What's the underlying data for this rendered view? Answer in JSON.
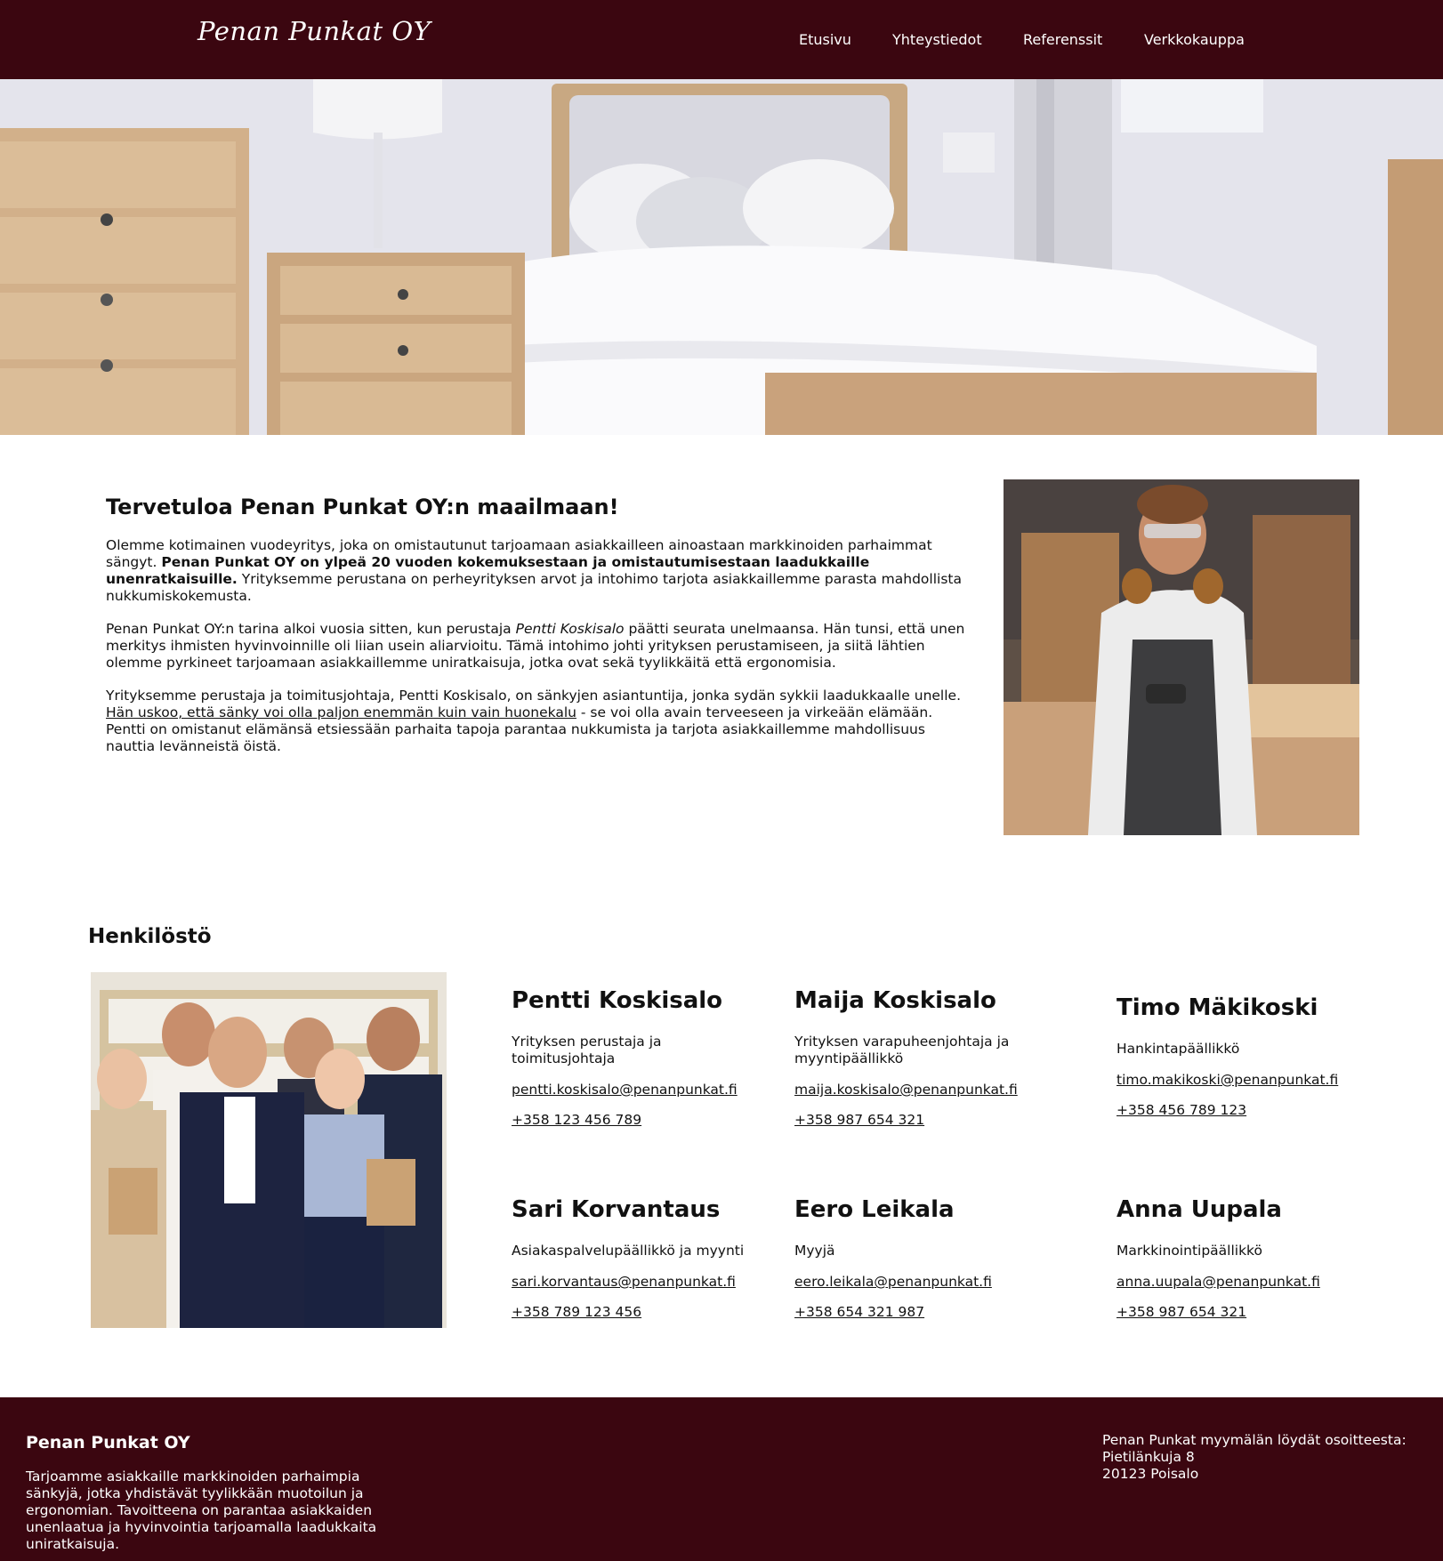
{
  "header": {
    "logo": "Penan Punkat OY",
    "nav": [
      {
        "label": "Etusivu"
      },
      {
        "label": "Yhteystiedot"
      },
      {
        "label": "Referenssit"
      },
      {
        "label": "Verkkokauppa"
      }
    ]
  },
  "intro": {
    "title": "Tervetuloa Penan Punkat OY:n maailmaan!",
    "p1_a": "Olemme kotimainen vuodeyritys, joka on omistautunut tarjoamaan asiakkailleen ainoastaan markkinoiden parhaimmat sängyt. ",
    "p1_bold": "Penan Punkat OY on ylpeä 20 vuoden kokemuksestaan ja omistautumisestaan laadukkaille unenratkaisuille.",
    "p1_b": " Yrityksemme perustana on perheyrityksen arvot ja intohimo tarjota asiakkaillemme parasta mahdollista nukkumiskokemusta.",
    "p2_a": "Penan Punkat OY:n tarina alkoi vuosia sitten, kun perustaja ",
    "p2_italic": "Pentti Koskisalo",
    "p2_b": " päätti seurata unelmaansa. Hän tunsi, että unen merkitys ihmisten hyvinvoinnille oli liian usein aliarvioitu. Tämä intohimo johti yrityksen perustamiseen, ja siitä lähtien olemme pyrkineet tarjoamaan asiakkaillemme uniratkaisuja, jotka ovat sekä tyylikkäitä että ergonomisia.",
    "p3_a": "Yrityksemme perustaja ja toimitusjohtaja, Pentti Koskisalo, on sänkyjen asiantuntija, jonka sydän sykkii laadukkaalle unelle. ",
    "p3_underline": "Hän uskoo, että sänky voi olla paljon enemmän kuin vain huonekalu",
    "p3_b": " - se voi olla avain terveeseen ja virkeään elämään. Pentti on omistanut elämänsä etsiessään parhaita tapoja parantaa nukkumista ja tarjota asiakkaillemme mahdollisuus nauttia levänneistä öistä."
  },
  "staff": {
    "title": "Henkilöstö",
    "members": [
      {
        "name": "Pentti Koskisalo",
        "role": "Yrityksen perustaja ja toimitusjohtaja",
        "email": "pentti.koskisalo@penanpunkat.fi",
        "phone": "+358 123 456 789"
      },
      {
        "name": "Maija Koskisalo",
        "role": "Yrityksen varapuheenjohtaja ja myyntipäällikkö",
        "email": "maija.koskisalo@penanpunkat.fi",
        "phone": "+358 987 654 321"
      },
      {
        "name": "Timo Mäkikoski",
        "role": "Hankintapäällikkö",
        "email": "timo.makikoski@penanpunkat.fi",
        "phone": "+358 456 789 123"
      },
      {
        "name": "Sari Korvantaus",
        "role": "Asiakaspalvelupäällikkö ja myynti",
        "email": "sari.korvantaus@penanpunkat.fi",
        "phone": "+358 789 123 456"
      },
      {
        "name": "Eero Leikala",
        "role": "Myyjä",
        "email": "eero.leikala@penanpunkat.fi",
        "phone": "+358 654 321 987"
      },
      {
        "name": "Anna Uupala",
        "role": "Markkinointipäällikkö",
        "email": "anna.uupala@penanpunkat.fi",
        "phone": "+358 987 654 321"
      }
    ]
  },
  "footer": {
    "brand": "Penan Punkat OY",
    "description": "Tarjoamme asiakkaille markkinoiden parhaimpia sänkyjä, jotka yhdistävät tyylikkään muotoilun ja ergonomian. Tavoitteena on parantaa asiakkaiden unenlaatua ja hyvinvointia tarjoamalla laadukkaita uniratkaisuja.",
    "address_intro": "Penan Punkat myymälän löydät osoitteesta:",
    "street": "Pietilänkuja 8",
    "city": "20123 Poisalo"
  },
  "colors": {
    "brand": "#3b0610",
    "text": "#111111",
    "background": "#ffffff"
  }
}
